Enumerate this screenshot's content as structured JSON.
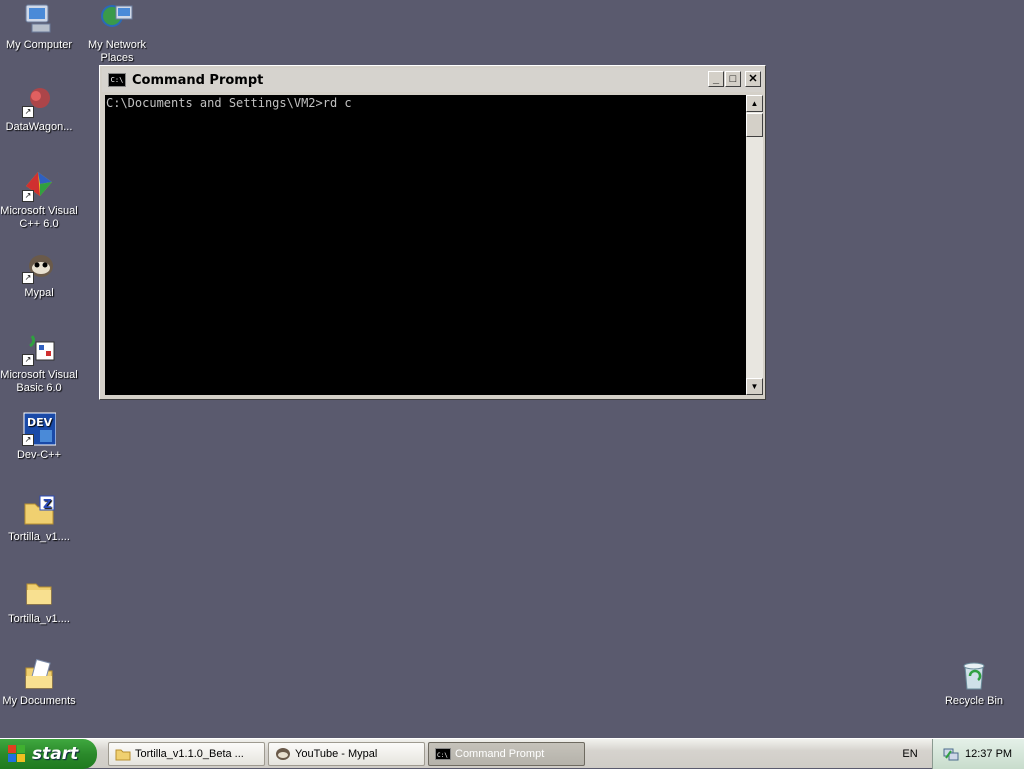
{
  "desktop": {
    "icons": [
      {
        "label": "My Computer",
        "icon": "my-computer-icon"
      },
      {
        "label": "My Network Places",
        "icon": "network-places-icon"
      },
      {
        "label": "DataWagon...",
        "icon": "datawagon-icon"
      },
      {
        "label": "Microsoft Visual C++ 6.0",
        "icon": "visual-cpp-icon"
      },
      {
        "label": "Mypal",
        "icon": "mypal-icon"
      },
      {
        "label": "Microsoft Visual Basic 6.0",
        "icon": "visual-basic-icon"
      },
      {
        "label": "Dev-C++",
        "icon": "devcpp-icon"
      },
      {
        "label": "Tortilla_v1....",
        "icon": "zip-folder-icon"
      },
      {
        "label": "Tortilla_v1....",
        "icon": "folder-icon"
      },
      {
        "label": "My Documents",
        "icon": "my-documents-icon"
      },
      {
        "label": "Recycle Bin",
        "icon": "recycle-bin-icon"
      }
    ]
  },
  "cmd_window": {
    "title": "Command Prompt",
    "icon_text": "C:\\",
    "minimize": "_",
    "maximize": "□",
    "close": "✕",
    "console_text": "C:\\Documents and Settings\\VM2>rd c",
    "scroll_up": "▲",
    "scroll_down": "▼"
  },
  "taskbar": {
    "start_label": "start",
    "buttons": [
      {
        "label": "Tortilla_v1.1.0_Beta ...",
        "icon": "folder-icon"
      },
      {
        "label": "YouTube - Mypal",
        "icon": "mypal-icon"
      },
      {
        "label": "Command Prompt",
        "icon": "cmd-icon"
      }
    ],
    "language": "EN",
    "clock": "12:37 PM"
  },
  "colors": {
    "desktop_bg": "#5a5a6e",
    "start_green": "#2b8a2b",
    "console_bg": "#000000",
    "console_fg": "#c0c0c0"
  }
}
